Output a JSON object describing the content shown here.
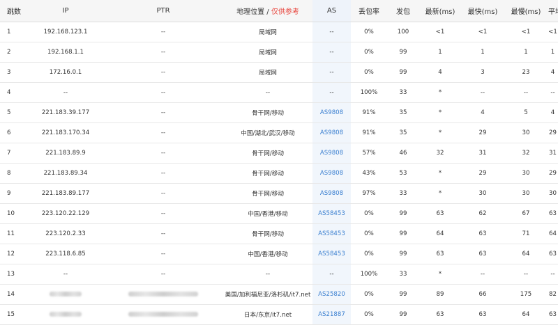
{
  "headers": {
    "hop": "跳数",
    "ip": "IP",
    "ptr": "PTR",
    "geo": "地理位置",
    "geo_sep": " / ",
    "geo_warn": "仅供参考",
    "as": "AS",
    "loss": "丢包率",
    "sent": "发包",
    "last": "最新(ms)",
    "best": "最快(ms)",
    "worst": "最慢(ms)",
    "avg": "平均(ms)"
  },
  "rows": [
    {
      "hop": "1",
      "ip": "192.168.123.1",
      "ptr": "--",
      "geo": "局域网",
      "as": "--",
      "loss": "0%",
      "sent": "100",
      "last": "<1",
      "best": "<1",
      "worst": "<1",
      "avg": "<1"
    },
    {
      "hop": "2",
      "ip": "192.168.1.1",
      "ptr": "--",
      "geo": "局域网",
      "as": "--",
      "loss": "0%",
      "sent": "99",
      "last": "1",
      "best": "1",
      "worst": "1",
      "avg": "1"
    },
    {
      "hop": "3",
      "ip": "172.16.0.1",
      "ptr": "--",
      "geo": "局域网",
      "as": "--",
      "loss": "0%",
      "sent": "99",
      "last": "4",
      "best": "3",
      "worst": "23",
      "avg": "4"
    },
    {
      "hop": "4",
      "ip": "--",
      "ptr": "--",
      "geo": "--",
      "as": "--",
      "loss": "100%",
      "sent": "33",
      "last": "*",
      "best": "--",
      "worst": "--",
      "avg": "--"
    },
    {
      "hop": "5",
      "ip": "221.183.39.177",
      "ptr": "--",
      "geo": "骨干网/移动",
      "as": "AS9808",
      "loss": "91%",
      "sent": "35",
      "last": "*",
      "best": "4",
      "worst": "5",
      "avg": "4"
    },
    {
      "hop": "6",
      "ip": "221.183.170.34",
      "ptr": "--",
      "geo": "中国/湖北/武汉/移动",
      "as": "AS9808",
      "loss": "91%",
      "sent": "35",
      "last": "*",
      "best": "29",
      "worst": "30",
      "avg": "29"
    },
    {
      "hop": "7",
      "ip": "221.183.89.9",
      "ptr": "--",
      "geo": "骨干网/移动",
      "as": "AS9808",
      "loss": "57%",
      "sent": "46",
      "last": "32",
      "best": "31",
      "worst": "32",
      "avg": "31"
    },
    {
      "hop": "8",
      "ip": "221.183.89.34",
      "ptr": "--",
      "geo": "骨干网/移动",
      "as": "AS9808",
      "loss": "43%",
      "sent": "53",
      "last": "*",
      "best": "29",
      "worst": "30",
      "avg": "29"
    },
    {
      "hop": "9",
      "ip": "221.183.89.177",
      "ptr": "--",
      "geo": "骨干网/移动",
      "as": "AS9808",
      "loss": "97%",
      "sent": "33",
      "last": "*",
      "best": "30",
      "worst": "30",
      "avg": "30"
    },
    {
      "hop": "10",
      "ip": "223.120.22.129",
      "ptr": "--",
      "geo": "中国/香港/移动",
      "as": "AS58453",
      "loss": "0%",
      "sent": "99",
      "last": "63",
      "best": "62",
      "worst": "67",
      "avg": "63"
    },
    {
      "hop": "11",
      "ip": "223.120.2.33",
      "ptr": "--",
      "geo": "骨干网/移动",
      "as": "AS58453",
      "loss": "0%",
      "sent": "99",
      "last": "64",
      "best": "63",
      "worst": "71",
      "avg": "64"
    },
    {
      "hop": "12",
      "ip": "223.118.6.85",
      "ptr": "--",
      "geo": "中国/香港/移动",
      "as": "AS58453",
      "loss": "0%",
      "sent": "99",
      "last": "63",
      "best": "63",
      "worst": "64",
      "avg": "63"
    },
    {
      "hop": "13",
      "ip": "--",
      "ptr": "--",
      "geo": "--",
      "as": "--",
      "loss": "100%",
      "sent": "33",
      "last": "*",
      "best": "--",
      "worst": "--",
      "avg": "--"
    },
    {
      "hop": "14",
      "ip": "",
      "ptr": "",
      "geo": "美国/加利福尼亚/洛杉矶/it7.net",
      "as": "AS25820",
      "loss": "0%",
      "sent": "99",
      "last": "89",
      "best": "66",
      "worst": "175",
      "avg": "82",
      "redacted": true
    },
    {
      "hop": "15",
      "ip": "",
      "ptr": "",
      "geo": "日本/东京/it7.net",
      "as": "AS21887",
      "loss": "0%",
      "sent": "99",
      "last": "63",
      "best": "63",
      "worst": "64",
      "avg": "63",
      "redacted": true
    }
  ]
}
